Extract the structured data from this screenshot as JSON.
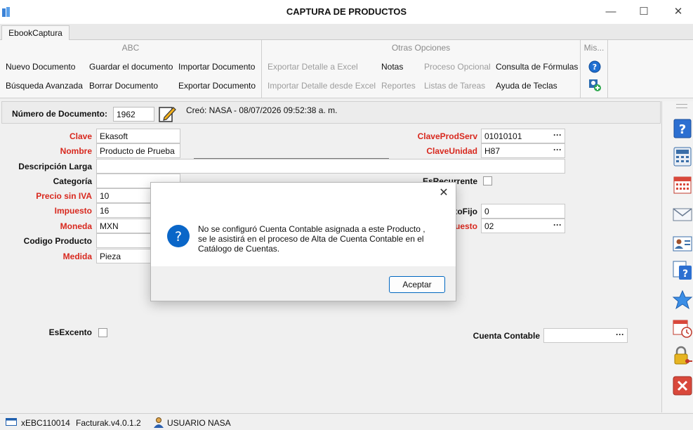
{
  "window": {
    "title": "CAPTURA DE PRODUCTOS",
    "minimize": "—",
    "maximize": "☐",
    "close": "✕"
  },
  "tabs": [
    "EbookCaptura"
  ],
  "ribbon": {
    "abc": {
      "title": "ABC",
      "nuevo": "Nuevo Documento",
      "guardar": "Guardar el documento",
      "importar": "Importar Documento",
      "busqueda": "Búsqueda Avanzada",
      "borrar": "Borrar Documento",
      "exportar": "Exportar Documento"
    },
    "otras": {
      "title": "Otras Opciones",
      "exportar_excel": "Exportar Detalle a Excel",
      "notas": "Notas",
      "proceso": "Proceso Opcional",
      "consulta": "Consulta de Fórmulas",
      "importar_excel": "Importar Detalle desde Excel",
      "reportes": "Reportes",
      "listas": "Listas de Tareas",
      "ayuda": "Ayuda de Teclas"
    },
    "mis": {
      "title": "Mis..."
    }
  },
  "document": {
    "label": "Número de Documento:",
    "number": "1962",
    "creo": "Creó: NASA - 08/07/2026 09:52:38 a. m."
  },
  "form": {
    "clave_label": "Clave",
    "clave_value": "Ekasoft",
    "nombre_label": "Nombre",
    "nombre_value": "Producto de Prueba",
    "descripcion_label": "Descripción Larga",
    "descripcion_value": "",
    "categoria_label": "Categoría",
    "precio_label": "Precio sin IVA",
    "precio_value": "10",
    "impuesto_label": "Impuesto",
    "impuesto_value": "16",
    "moneda_label": "Moneda",
    "moneda_value": "MXN",
    "codigo_label": "Codigo Producto",
    "medida_label": "Medida",
    "medida_value": "Pieza",
    "esexcento_label": "EsExcento",
    "claveprodserv_label": "ClaveProdServ",
    "claveprodserv_value": "01010101",
    "claveunidad_label": "ClaveUnidad",
    "claveunidad_value": "H87",
    "esrecurrente_label": "EsRecurrente",
    "tofijo_label": "toFijo",
    "tofijo_value": "0",
    "uesto_label": "uesto",
    "uesto_value": "02",
    "cuenta_label": "Cuenta Contable",
    "cuenta_value": "",
    "ellipsis": "···"
  },
  "dialog": {
    "line1": "No se configuró Cuenta Contable asignada a este Producto ,",
    "line2": "se le asistirá en el proceso de Alta de Cuenta Contable en el",
    "line3": "Catálogo de Cuentas.",
    "accept": "Aceptar",
    "close": "✕"
  },
  "statusbar": {
    "code": "xEBC110014",
    "version": "Facturak.v4.0.1.2",
    "user": "USUARIO NASA"
  },
  "colors": {
    "required_label": "#d8281e",
    "accent_blue": "#0067c0",
    "disabled_text": "#9d9d9d"
  },
  "icons": [
    "app-icon",
    "edit-pencil-icon",
    "help-icon",
    "user-add-icon",
    "question-icon",
    "calculator-icon",
    "calendar-icon",
    "mail-icon",
    "contact-card-icon",
    "help-document-icon",
    "star-icon",
    "calendar-clock-icon",
    "lock-key-icon",
    "delete-x-icon",
    "info-question-icon",
    "monitor-icon",
    "user-icon"
  ]
}
